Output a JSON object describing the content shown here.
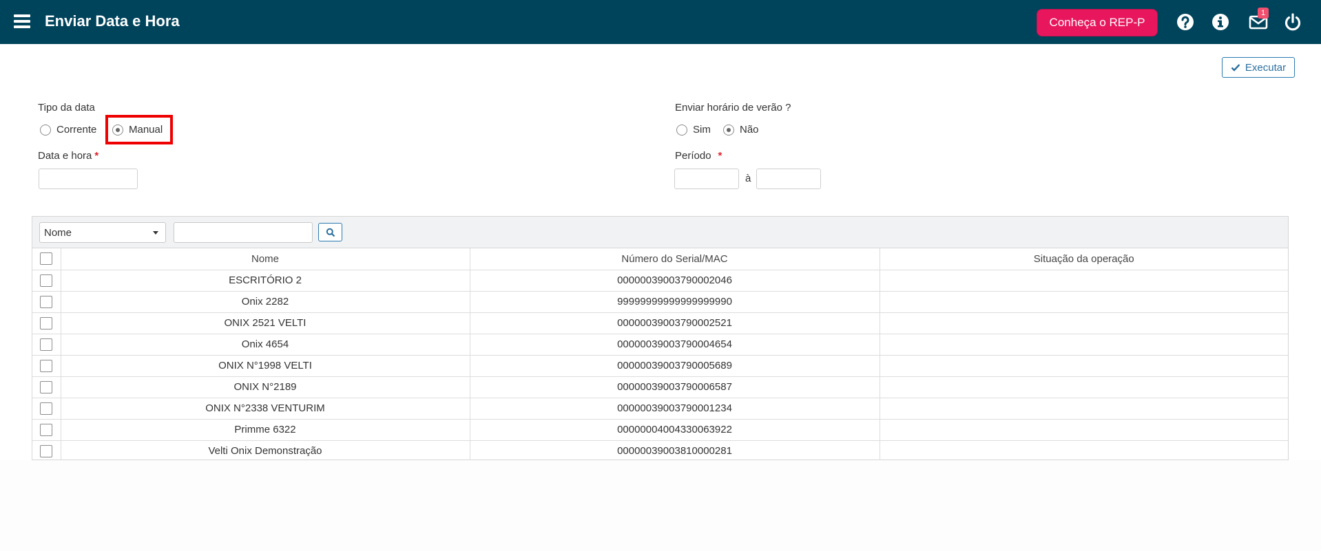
{
  "header": {
    "title": "Enviar Data e Hora",
    "promo_button": "Conheça o REP-P",
    "notification_count": "1",
    "icons": [
      "menu-icon",
      "help-icon",
      "info-icon",
      "mail-icon",
      "power-icon"
    ],
    "colors": {
      "bar": "#00445c",
      "promo": "#e8175d"
    }
  },
  "actions": {
    "execute_label": "Executar"
  },
  "form": {
    "date_type_label": "Tipo da data",
    "date_type_options": [
      "Corrente",
      "Manual"
    ],
    "date_type_selected": "Manual",
    "datetime_label": "Data e hora",
    "required_mark": "*",
    "datetime_value": "",
    "dst_label": "Enviar horário de verão ?",
    "dst_options": [
      "Sim",
      "Não"
    ],
    "dst_selected": "Não",
    "period_label": "Período",
    "period_separator": "à",
    "period_start": "",
    "period_end": ""
  },
  "grid": {
    "filter_field": "Nome",
    "search_value": "",
    "columns": [
      "Nome",
      "Número do Serial/MAC",
      "Situação da operação"
    ],
    "rows": [
      {
        "nome": "ESCRITÓRIO 2",
        "serial": "00000039003790002046",
        "situacao": ""
      },
      {
        "nome": "Onix 2282",
        "serial": "99999999999999999990",
        "situacao": ""
      },
      {
        "nome": "ONIX 2521 VELTI",
        "serial": "00000039003790002521",
        "situacao": ""
      },
      {
        "nome": "Onix 4654",
        "serial": "00000039003790004654",
        "situacao": ""
      },
      {
        "nome": "ONIX N°1998 VELTI",
        "serial": "00000039003790005689",
        "situacao": ""
      },
      {
        "nome": "ONIX N°2189",
        "serial": "00000039003790006587",
        "situacao": ""
      },
      {
        "nome": "ONIX N°2338 VENTURIM",
        "serial": "00000039003790001234",
        "situacao": ""
      },
      {
        "nome": "Primme 6322",
        "serial": "00000004004330063922",
        "situacao": ""
      },
      {
        "nome": "Velti Onix Demonstração",
        "serial": "00000039003810000281",
        "situacao": ""
      }
    ]
  }
}
